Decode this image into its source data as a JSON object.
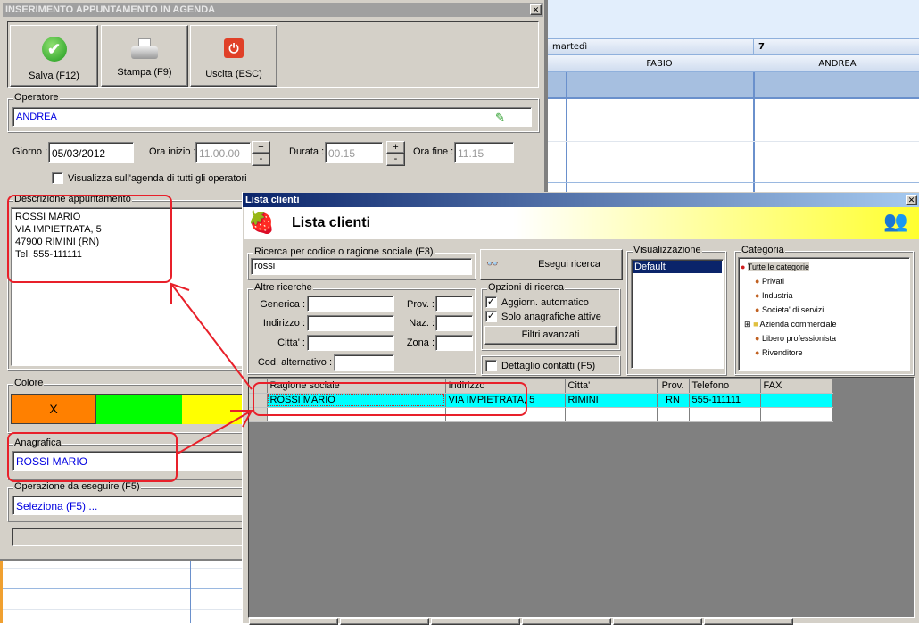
{
  "calendar": {
    "day": "martedì",
    "date": "7",
    "operators": [
      "FABIO",
      "ANDREA"
    ]
  },
  "appointment": {
    "title": "INSERIMENTO APPUNTAMENTO IN AGENDA",
    "toolbar": {
      "save": "Salva (F12)",
      "print": "Stampa (F9)",
      "exit": "Uscita (ESC)"
    },
    "operator_label": "Operatore",
    "operator_value": "ANDREA",
    "day_label": "Giorno :",
    "day_value": "05/03/2012",
    "start_label": "Ora inizio :",
    "start_value": "11.00.00",
    "duration_label": "Durata :",
    "duration_value": "00.15",
    "end_label": "Ora fine :",
    "end_value": "11.15",
    "plus": "+",
    "minus": "-",
    "show_all_label": "Visualizza sull'agenda di tutti gli operatori",
    "show_all_checked": false,
    "description_label": "Descrizione appuntamento",
    "description_lines": [
      "ROSSI MARIO",
      "VIA IMPIETRATA, 5",
      "47900 RIMINI (RN)",
      "Tel. 555-111111"
    ],
    "color_label": "Colore",
    "colors": [
      "#ff8000",
      "#00ff00",
      "#ffff00"
    ],
    "selected_color_mark": "X",
    "registry_label": "Anagrafica",
    "registry_value": "ROSSI MARIO",
    "operation_label": "Operazione da eseguire (F5)",
    "operation_value": "Seleziona (F5) ..."
  },
  "clients": {
    "title": "Lista clienti",
    "header": "Lista clienti",
    "search_label": "Ricerca per codice o ragione sociale (F3)",
    "search_value": "rossi",
    "search_button": "Esegui ricerca",
    "other_label": "Altre ricerche",
    "generic": "Generica :",
    "address": "Indirizzo :",
    "city": "Citta' :",
    "alt_code": "Cod. alternativo :",
    "prov": "Prov. :",
    "naz": "Naz. :",
    "zona": "Zona :",
    "options_label": "Opzioni di ricerca",
    "auto_update": "Aggiorn. automatico",
    "auto_update_checked": true,
    "only_active": "Solo anagrafiche attive",
    "only_active_checked": true,
    "advanced_filters": "Filtri avanzati",
    "contact_detail": "Dettaglio contatti (F5)",
    "contact_detail_checked": false,
    "view_label": "Visualizzazione",
    "views": [
      "Default"
    ],
    "category_label": "Categoria",
    "categories": [
      "Tutte le categorie",
      "Privati",
      "Industria",
      "Societa' di servizi",
      "Azienda commerciale",
      "Libero professionista",
      "Rivenditore"
    ],
    "columns": [
      "Ragione sociale",
      "Indirizzo",
      "Citta'",
      "Prov.",
      "Telefono",
      "FAX"
    ],
    "rows": [
      [
        "ROSSI MARIO",
        "VIA IMPIETRATA, 5",
        "RIMINI",
        "RN",
        "555-111111",
        ""
      ]
    ]
  }
}
